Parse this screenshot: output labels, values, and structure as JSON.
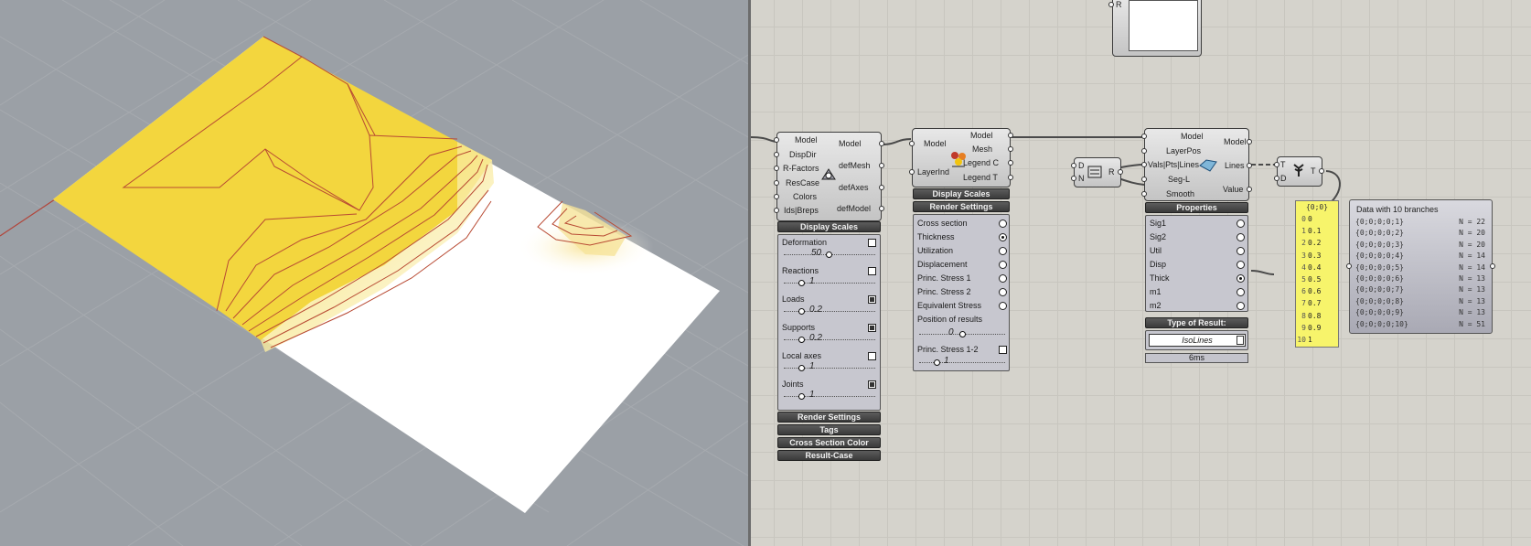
{
  "viewport": {
    "colors": {
      "background": "#9ba0a6",
      "result_fill": "#f2d43a",
      "contour": "#b33a2a",
      "grid": "#a7abb0"
    }
  },
  "components": {
    "display": {
      "inputs": [
        "Model",
        "DispDir",
        "R-Factors",
        "ResCase",
        "Colors",
        "Ids|Breps"
      ],
      "outputs": [
        "Model",
        "defMesh",
        "defAxes",
        "defModel"
      ],
      "header": "Display Scales",
      "rows": [
        {
          "label": "Deformation",
          "checked": false,
          "value": "50"
        },
        {
          "label": "Reactions",
          "checked": false,
          "value": "1"
        },
        {
          "label": "Loads",
          "checked": true,
          "value": "0.2"
        },
        {
          "label": "Supports",
          "checked": true,
          "value": "0.2"
        },
        {
          "label": "Local axes",
          "checked": false,
          "value": "1"
        },
        {
          "label": "Joints",
          "checked": true,
          "value": "1"
        }
      ],
      "footer_bars": [
        "Render Settings",
        "Tags",
        "Cross Section Color",
        "Result-Case"
      ]
    },
    "results": {
      "inputs": [
        "Model",
        "LayerInd"
      ],
      "outputs": [
        "Model",
        "Mesh",
        "Legend C",
        "Legend T"
      ],
      "bars": [
        "Display Scales",
        "Render Settings"
      ],
      "options": [
        {
          "label": "Cross section",
          "selected": false
        },
        {
          "label": "Thickness",
          "selected": true
        },
        {
          "label": "Utilization",
          "selected": false
        },
        {
          "label": "Displacement",
          "selected": false
        },
        {
          "label": "Princ. Stress 1",
          "selected": false
        },
        {
          "label": "Princ. Stress 2",
          "selected": false
        },
        {
          "label": "Equivalent Stress",
          "selected": false
        }
      ],
      "position_label": "Position of results",
      "position_value": "0",
      "princ_label": "Princ. Stress 1-2",
      "princ_value": "1"
    },
    "series": {
      "inputs": [
        "D",
        "N"
      ],
      "outputs": [
        "R"
      ]
    },
    "isolines": {
      "inputs": [
        "Model",
        "LayerPos",
        "Vals|Pts|Lines",
        "Seg-L",
        "Smooth"
      ],
      "outputs": [
        "Lines",
        "Value"
      ],
      "model_out": "Model",
      "properties_bar": "Properties",
      "options": [
        {
          "label": "Sig1",
          "selected": false
        },
        {
          "label": "Sig2",
          "selected": false
        },
        {
          "label": "Util",
          "selected": false
        },
        {
          "label": "Disp",
          "selected": false
        },
        {
          "label": "Thick",
          "selected": true
        },
        {
          "label": "m1",
          "selected": false
        },
        {
          "label": "m2",
          "selected": false
        }
      ],
      "type_bar": "Type of Result:",
      "type_value": "IsoLines",
      "timing": "6ms"
    },
    "tree": {
      "inputs": [
        "T",
        "D"
      ],
      "outputs": [
        "T"
      ]
    },
    "top_param": {
      "outputs": [
        "R"
      ]
    },
    "panel": {
      "header": "{0;0}",
      "items": [
        {
          "index": "0",
          "value": "0"
        },
        {
          "index": "1",
          "value": "0.1"
        },
        {
          "index": "2",
          "value": "0.2"
        },
        {
          "index": "3",
          "value": "0.3"
        },
        {
          "index": "4",
          "value": "0.4"
        },
        {
          "index": "5",
          "value": "0.5"
        },
        {
          "index": "6",
          "value": "0.6"
        },
        {
          "index": "7",
          "value": "0.7"
        },
        {
          "index": "8",
          "value": "0.8"
        },
        {
          "index": "9",
          "value": "0.9"
        },
        {
          "index": "10",
          "value": "1"
        }
      ]
    },
    "viewer": {
      "title": "Data with 10 branches",
      "branches": [
        {
          "path": "{0;0;0;0;1}",
          "count": "N = 22"
        },
        {
          "path": "{0;0;0;0;2}",
          "count": "N = 20"
        },
        {
          "path": "{0;0;0;0;3}",
          "count": "N = 20"
        },
        {
          "path": "{0;0;0;0;4}",
          "count": "N = 14"
        },
        {
          "path": "{0;0;0;0;5}",
          "count": "N = 14"
        },
        {
          "path": "{0;0;0;0;6}",
          "count": "N = 13"
        },
        {
          "path": "{0;0;0;0;7}",
          "count": "N = 13"
        },
        {
          "path": "{0;0;0;0;8}",
          "count": "N = 13"
        },
        {
          "path": "{0;0;0;0;9}",
          "count": "N = 13"
        },
        {
          "path": "{0;0;0;0;10}",
          "count": "N = 51"
        }
      ]
    }
  }
}
